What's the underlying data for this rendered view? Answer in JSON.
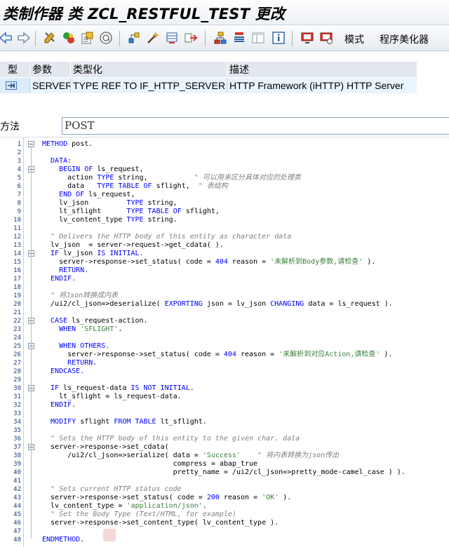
{
  "window": {
    "title": "类制作器 类 ZCL_RESTFUL_TEST 更改"
  },
  "toolbar": {
    "icons": [
      "back-arrow-icon",
      "forward-arrow-icon",
      "display-change-icon",
      "active-inactive-icon",
      "object-list-icon",
      "where-used-icon",
      "check-syntax-icon",
      "activate-icon",
      "test-icon",
      "navigate-icon",
      "hierarchy-icon",
      "attributes-icon",
      "layout-icon",
      "info-icon",
      "screen-icon",
      "debug-icon"
    ],
    "pattern_label": "模式",
    "pretty_printer_label": "程序美化器"
  },
  "params": {
    "headers": [
      "型",
      "参数",
      "类型化",
      "描述"
    ],
    "row": {
      "icon": "import-param-icon",
      "name": "SERVER",
      "typing": "TYPE REF TO IF_HTTP_SERVER",
      "description": "HTTP Framework (iHTTP) HTTP Server"
    }
  },
  "method": {
    "label": "方法",
    "value": "POST"
  },
  "code": {
    "line_numbers": [
      "1",
      "2",
      "3",
      "4",
      "5",
      "6",
      "7",
      "8",
      "9",
      "10",
      "11",
      "12",
      "13",
      "14",
      "15",
      "16",
      "17",
      "18",
      "19",
      "20",
      "21",
      "22",
      "23",
      "24",
      "25",
      "26",
      "27",
      "28",
      "29",
      "30",
      "31",
      "32",
      "33",
      "34",
      "35",
      "36",
      "37",
      "38",
      "39",
      "40",
      "41",
      "42",
      "43",
      "44",
      "45",
      "46",
      "47",
      "48"
    ],
    "lines": [
      [
        [
          "kw",
          "METHOD "
        ],
        [
          "nm",
          "post."
        ]
      ],
      [],
      [
        [
          "kw",
          "  DATA:"
        ]
      ],
      [
        [
          "kw",
          "    BEGIN OF "
        ],
        [
          "nm",
          "ls_request,"
        ]
      ],
      [
        [
          "nm",
          "      action "
        ],
        [
          "kw",
          "TYPE "
        ],
        [
          "nm",
          "string,"
        ],
        [
          "cm",
          "           \" 可以用来区分具体对应的处理类"
        ]
      ],
      [
        [
          "nm",
          "      data   "
        ],
        [
          "kw",
          "TYPE TABLE OF "
        ],
        [
          "nm",
          "sflight,"
        ],
        [
          "cm",
          "  \" 表结构"
        ]
      ],
      [
        [
          "kw",
          "    END OF "
        ],
        [
          "nm",
          "ls_request,"
        ]
      ],
      [
        [
          "nm",
          "    lv_json         "
        ],
        [
          "kw",
          "TYPE "
        ],
        [
          "nm",
          "string,"
        ]
      ],
      [
        [
          "nm",
          "    lt_sflight      "
        ],
        [
          "kw",
          "TYPE TABLE OF "
        ],
        [
          "nm",
          "sflight,"
        ]
      ],
      [
        [
          "nm",
          "    lv_content_type "
        ],
        [
          "kw",
          "TYPE "
        ],
        [
          "nm",
          "string."
        ]
      ],
      [],
      [
        [
          "cm",
          "  \" Delivers the HTTP body of this entity as character data"
        ]
      ],
      [
        [
          "nm",
          "  lv_json  = server->request->get_cdata( )."
        ]
      ],
      [
        [
          "kw",
          "  IF "
        ],
        [
          "nm",
          "lv_json "
        ],
        [
          "kw",
          "IS INITIAL."
        ]
      ],
      [
        [
          "nm",
          "    server->response->set_status( code = "
        ],
        [
          "kw",
          "404"
        ],
        [
          "nm",
          " reason = "
        ],
        [
          "st",
          "'未解析到Body参数,请检查'"
        ],
        [
          "nm",
          " )."
        ]
      ],
      [
        [
          "kw",
          "    RETURN."
        ]
      ],
      [
        [
          "kw",
          "  ENDIF."
        ]
      ],
      [],
      [
        [
          "cm",
          "  \" 将Json转换成内表"
        ]
      ],
      [
        [
          "nm",
          "  /ui2/cl_json=>deserialize( "
        ],
        [
          "kw",
          "EXPORTING "
        ],
        [
          "nm",
          "json = lv_json "
        ],
        [
          "kw",
          "CHANGING "
        ],
        [
          "nm",
          "data = ls_request )."
        ]
      ],
      [],
      [
        [
          "kw",
          "  CASE "
        ],
        [
          "nm",
          "ls_request-action."
        ]
      ],
      [
        [
          "kw",
          "    WHEN "
        ],
        [
          "st",
          "'SFLIGHT'"
        ],
        [
          "nm",
          "."
        ]
      ],
      [],
      [
        [
          "kw",
          "    WHEN OTHERS."
        ]
      ],
      [
        [
          "nm",
          "      server->response->set_status( code = "
        ],
        [
          "kw",
          "404"
        ],
        [
          "nm",
          " reason = "
        ],
        [
          "st",
          "'未解析到对应Action,请检查'"
        ],
        [
          "nm",
          " )."
        ]
      ],
      [
        [
          "kw",
          "      RETURN."
        ]
      ],
      [
        [
          "kw",
          "  ENDCASE."
        ]
      ],
      [],
      [
        [
          "kw",
          "  IF "
        ],
        [
          "nm",
          "ls_request-data "
        ],
        [
          "kw",
          "IS NOT INITIAL."
        ]
      ],
      [
        [
          "nm",
          "    lt_sflight = ls_request-data."
        ]
      ],
      [
        [
          "kw",
          "  ENDIF."
        ]
      ],
      [],
      [
        [
          "kw",
          "  MODIFY "
        ],
        [
          "nm",
          "sflight "
        ],
        [
          "kw",
          "FROM TABLE "
        ],
        [
          "nm",
          "lt_sflight."
        ]
      ],
      [],
      [
        [
          "cm",
          "  \" Sets the HTTP body of this entity to the given char. data"
        ]
      ],
      [
        [
          "nm",
          "  server->response->set_cdata("
        ]
      ],
      [
        [
          "nm",
          "      /ui2/cl_json=>serialize( data = "
        ],
        [
          "st",
          "'Success'"
        ],
        [
          "cm",
          "    \" 将内表转换为json传出"
        ]
      ],
      [
        [
          "nm",
          "                               compress = abap_true"
        ]
      ],
      [
        [
          "nm",
          "                               pretty_name = /ui2/cl_json=>pretty_mode-camel_case ) )."
        ]
      ],
      [],
      [
        [
          "cm",
          "  \" Sets current HTTP status code"
        ]
      ],
      [
        [
          "nm",
          "  server->response->set_status( code = "
        ],
        [
          "kw",
          "200"
        ],
        [
          "nm",
          " reason = "
        ],
        [
          "st",
          "'OK'"
        ],
        [
          "nm",
          " )."
        ]
      ],
      [
        [
          "nm",
          "  lv_content_type = "
        ],
        [
          "st",
          "'application/json'"
        ],
        [
          "nm",
          "."
        ]
      ],
      [
        [
          "cm",
          "  \" Set the Body Type (Text/HTML, for example)"
        ]
      ],
      [
        [
          "nm",
          "  server->response->set_content_type( lv_content_type )."
        ]
      ],
      [],
      [
        [
          "kw",
          "ENDMETHOD"
        ],
        [
          "nm",
          "."
        ]
      ]
    ]
  }
}
